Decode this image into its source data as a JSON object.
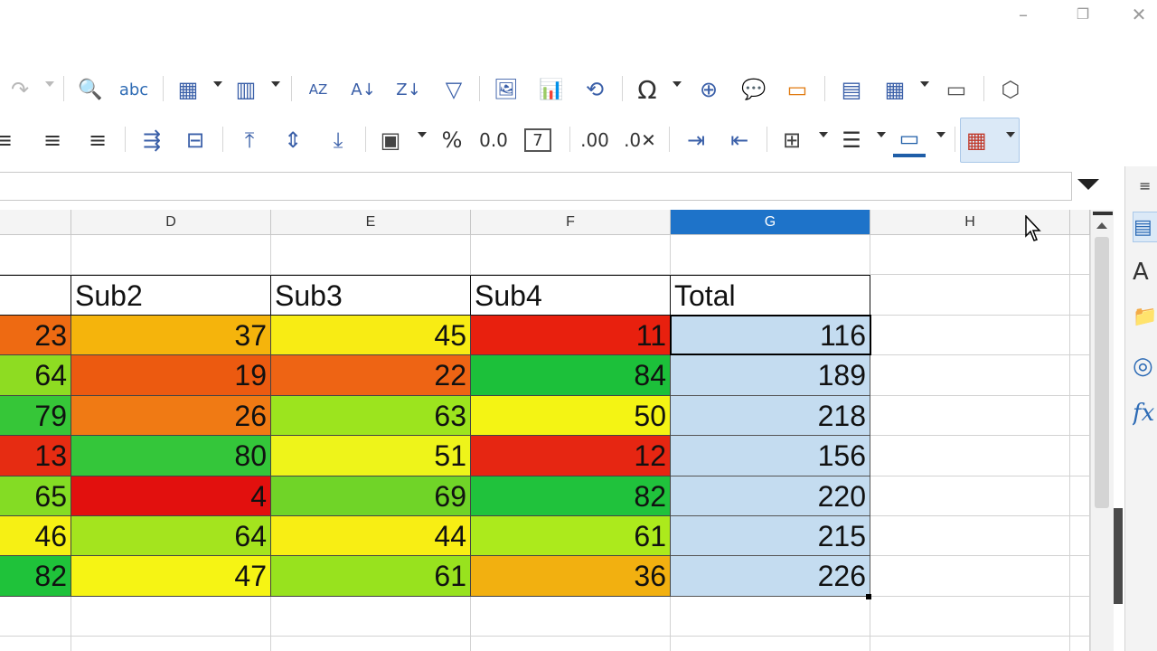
{
  "window": {
    "controls": [
      "–",
      "❐",
      "✕"
    ]
  },
  "toolbar1": {
    "items": [
      {
        "name": "redo-icon",
        "glyph": "↷"
      },
      {
        "name": "find-replace-icon",
        "glyph": "🔍"
      },
      {
        "name": "spelling-icon",
        "glyph": "abc"
      },
      {
        "name": "row-icon",
        "glyph": "▦"
      },
      {
        "name": "column-icon",
        "glyph": "▥"
      },
      {
        "name": "sort-icon",
        "glyph": "AZ"
      },
      {
        "name": "sort-ascending-icon",
        "glyph": "A↓"
      },
      {
        "name": "sort-descending-icon",
        "glyph": "Z↓"
      },
      {
        "name": "autofilter-icon",
        "glyph": "▽"
      },
      {
        "name": "insert-image-icon",
        "glyph": "🖼"
      },
      {
        "name": "insert-chart-icon",
        "glyph": "📊"
      },
      {
        "name": "pivot-table-icon",
        "glyph": "⟲"
      },
      {
        "name": "special-character-icon",
        "glyph": "Ω"
      },
      {
        "name": "hyperlink-icon",
        "glyph": "⊕"
      },
      {
        "name": "comment-icon",
        "glyph": "💬"
      },
      {
        "name": "headers-footers-icon",
        "glyph": "▭"
      },
      {
        "name": "define-print-area-icon",
        "glyph": "▤"
      },
      {
        "name": "freeze-rows-columns-icon",
        "glyph": "▦"
      },
      {
        "name": "split-window-icon",
        "glyph": "▭"
      },
      {
        "name": "show-draw-functions-icon",
        "glyph": "⬡"
      }
    ]
  },
  "toolbar2": {
    "items": [
      {
        "name": "align-left-icon",
        "glyph": "≡"
      },
      {
        "name": "align-center-icon",
        "glyph": "≡"
      },
      {
        "name": "align-right-icon",
        "glyph": "≡"
      },
      {
        "name": "wrap-text-icon",
        "glyph": "⇶"
      },
      {
        "name": "merge-center-icon",
        "glyph": "⊟"
      },
      {
        "name": "align-top-icon",
        "glyph": "⤒"
      },
      {
        "name": "align-middle-icon",
        "glyph": "⇕"
      },
      {
        "name": "align-bottom-icon",
        "glyph": "⤓"
      },
      {
        "name": "currency-format-icon",
        "glyph": "▣"
      },
      {
        "name": "percent-format-icon",
        "glyph": "%"
      },
      {
        "name": "number-format-icon",
        "glyph": "0.0"
      },
      {
        "name": "date-format-icon",
        "glyph": "7"
      },
      {
        "name": "add-decimal-icon",
        "glyph": ".00"
      },
      {
        "name": "delete-decimal-icon",
        "glyph": ".0✕"
      },
      {
        "name": "increase-indent-icon",
        "glyph": "⇥"
      },
      {
        "name": "decrease-indent-icon",
        "glyph": "⇤"
      },
      {
        "name": "borders-icon",
        "glyph": "⊞"
      },
      {
        "name": "border-style-icon",
        "glyph": "☰"
      },
      {
        "name": "border-color-icon",
        "glyph": "▭"
      },
      {
        "name": "conditional-format-icon",
        "glyph": "▦"
      }
    ]
  },
  "columns": [
    {
      "label": ""
    },
    {
      "label": "D"
    },
    {
      "label": "E"
    },
    {
      "label": "F"
    },
    {
      "label": "G"
    },
    {
      "label": "H"
    }
  ],
  "table": {
    "headers": [
      "",
      "Sub2",
      "Sub3",
      "Sub4",
      "Total"
    ],
    "rows": [
      {
        "values": [
          "23",
          "37",
          "45",
          "11",
          "116"
        ],
        "colors": [
          "#ee6a12",
          "#f5b40c",
          "#f8ec14",
          "#e8200e"
        ]
      },
      {
        "values": [
          "64",
          "19",
          "22",
          "84",
          "189"
        ],
        "colors": [
          "#8edc22",
          "#ec5a10",
          "#ee6414",
          "#1cc03a"
        ]
      },
      {
        "values": [
          "79",
          "26",
          "63",
          "50",
          "218"
        ],
        "colors": [
          "#36c638",
          "#f07a14",
          "#9ce41e",
          "#f4f414"
        ]
      },
      {
        "values": [
          "13",
          "80",
          "51",
          "12",
          "156"
        ],
        "colors": [
          "#e62c12",
          "#34c63a",
          "#eef41a",
          "#e62612"
        ]
      },
      {
        "values": [
          "65",
          "4",
          "69",
          "82",
          "220"
        ],
        "colors": [
          "#84dc24",
          "#e2100e",
          "#70d428",
          "#20c23c"
        ]
      },
      {
        "values": [
          "46",
          "64",
          "44",
          "61",
          "215"
        ],
        "colors": [
          "#f6f014",
          "#a4e41e",
          "#f8ee14",
          "#acea1c"
        ]
      },
      {
        "values": [
          "82",
          "47",
          "61",
          "36",
          "226"
        ],
        "colors": [
          "#1fc23a",
          "#f6f414",
          "#98e21e",
          "#f2b010"
        ]
      }
    ]
  },
  "colors": {
    "selection_fill": "#c4dcf0",
    "selected_header": "#1e73c9"
  },
  "sidebar": {
    "icons": [
      "properties-icon",
      "styles-icon",
      "gallery-icon",
      "navigator-icon",
      "functions-icon"
    ],
    "glyphs": [
      "▤",
      "A",
      "📁",
      "◎",
      "fx"
    ]
  }
}
